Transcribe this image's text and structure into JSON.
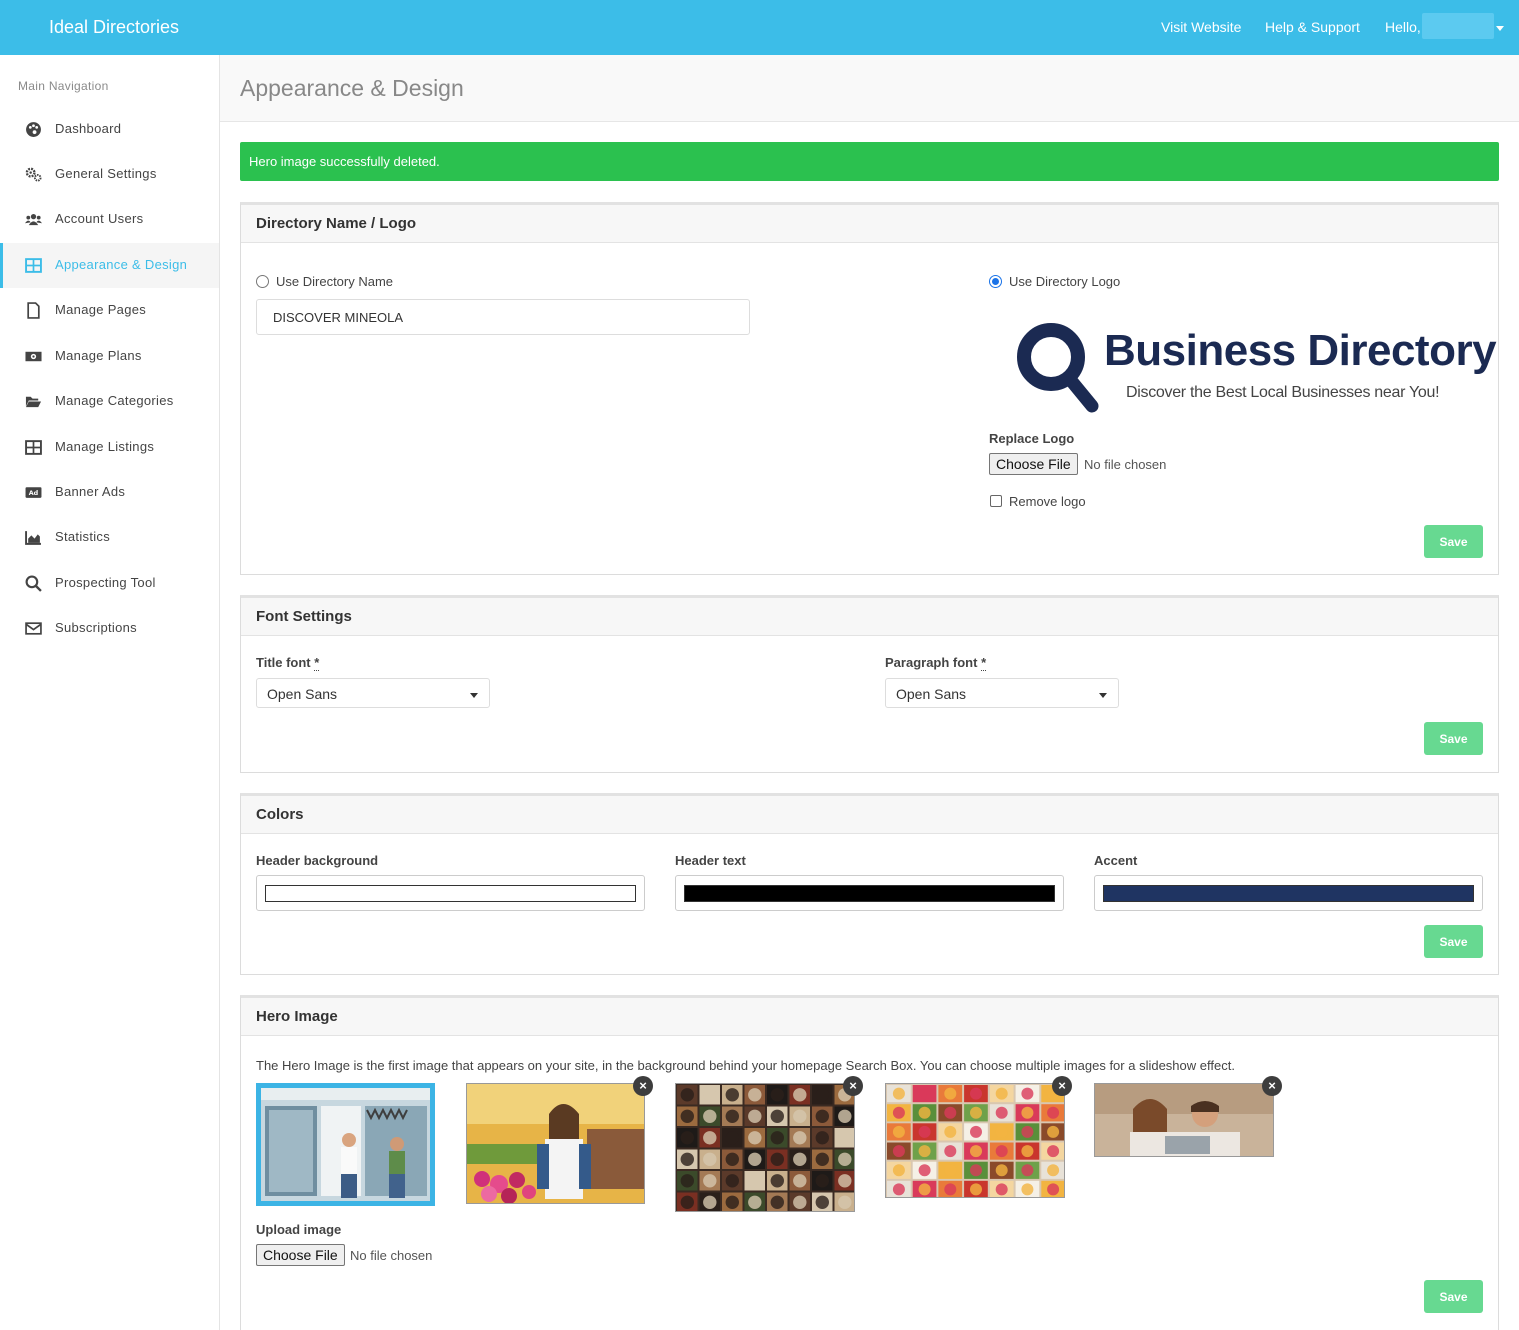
{
  "topbar": {
    "brand": "Ideal Directories",
    "visit_website": "Visit Website",
    "help_support": "Help & Support",
    "hello": "Hello,"
  },
  "sidebar": {
    "heading": "Main Navigation",
    "items": [
      {
        "label": "Dashboard",
        "icon": "palette-icon"
      },
      {
        "label": "General Settings",
        "icon": "cogs-icon"
      },
      {
        "label": "Account Users",
        "icon": "users-icon"
      },
      {
        "label": "Appearance & Design",
        "icon": "grid-icon",
        "active": true
      },
      {
        "label": "Manage Pages",
        "icon": "file-icon"
      },
      {
        "label": "Manage Plans",
        "icon": "money-icon"
      },
      {
        "label": "Manage Categories",
        "icon": "folder-open-icon"
      },
      {
        "label": "Manage Listings",
        "icon": "table-icon"
      },
      {
        "label": "Banner Ads",
        "icon": "ad-icon"
      },
      {
        "label": "Statistics",
        "icon": "area-chart-icon"
      },
      {
        "label": "Prospecting Tool",
        "icon": "search-icon"
      },
      {
        "label": "Subscriptions",
        "icon": "envelope-icon"
      }
    ]
  },
  "page": {
    "title": "Appearance & Design",
    "alert": "Hero image successfully deleted."
  },
  "logo_panel": {
    "title": "Directory Name / Logo",
    "use_name_label": "Use Directory Name",
    "use_name_selected": false,
    "name_value": "DISCOVER MINEOLA",
    "use_logo_label": "Use Directory Logo",
    "use_logo_selected": true,
    "logo": {
      "title": "Business Directory",
      "tagline": "Discover the Best Local Businesses near You!",
      "color": "#1b2a52"
    },
    "replace_logo_label": "Replace Logo",
    "choose_file": "Choose File",
    "no_file": "No file chosen",
    "remove_logo_label": "Remove logo",
    "save": "Save"
  },
  "font_panel": {
    "title": "Font Settings",
    "title_font_label": "Title font",
    "title_font_value": "Open Sans",
    "paragraph_font_label": "Paragraph font",
    "paragraph_font_value": "Open Sans",
    "required_mark": "*",
    "save": "Save"
  },
  "colors_panel": {
    "title": "Colors",
    "header_background_label": "Header background",
    "header_background": "#ffffff",
    "header_text_label": "Header text",
    "header_text": "#000000",
    "accent_label": "Accent",
    "accent": "#1f3462",
    "save": "Save"
  },
  "hero_panel": {
    "title": "Hero Image",
    "description": "The Hero Image is the first image that appears on your site, in the background behind your homepage Search Box. You can choose multiple images for a slideshow effect.",
    "images": [
      {
        "name": "storefront-couple-image",
        "selected": true
      },
      {
        "name": "florist-woman-image",
        "removable": true
      },
      {
        "name": "food-collage-dark-image",
        "removable": true
      },
      {
        "name": "food-collage-bright-image",
        "removable": true
      },
      {
        "name": "couple-laptop-image",
        "removable": true
      }
    ],
    "remove_glyph": "×",
    "upload_label": "Upload image",
    "choose_file": "Choose File",
    "no_file": "No file chosen",
    "save": "Save"
  },
  "colors": {
    "topbar": "#3cbde8",
    "active_nav": "#3cbde8",
    "alert": "#2bc14f",
    "save_button": "#67d991"
  }
}
